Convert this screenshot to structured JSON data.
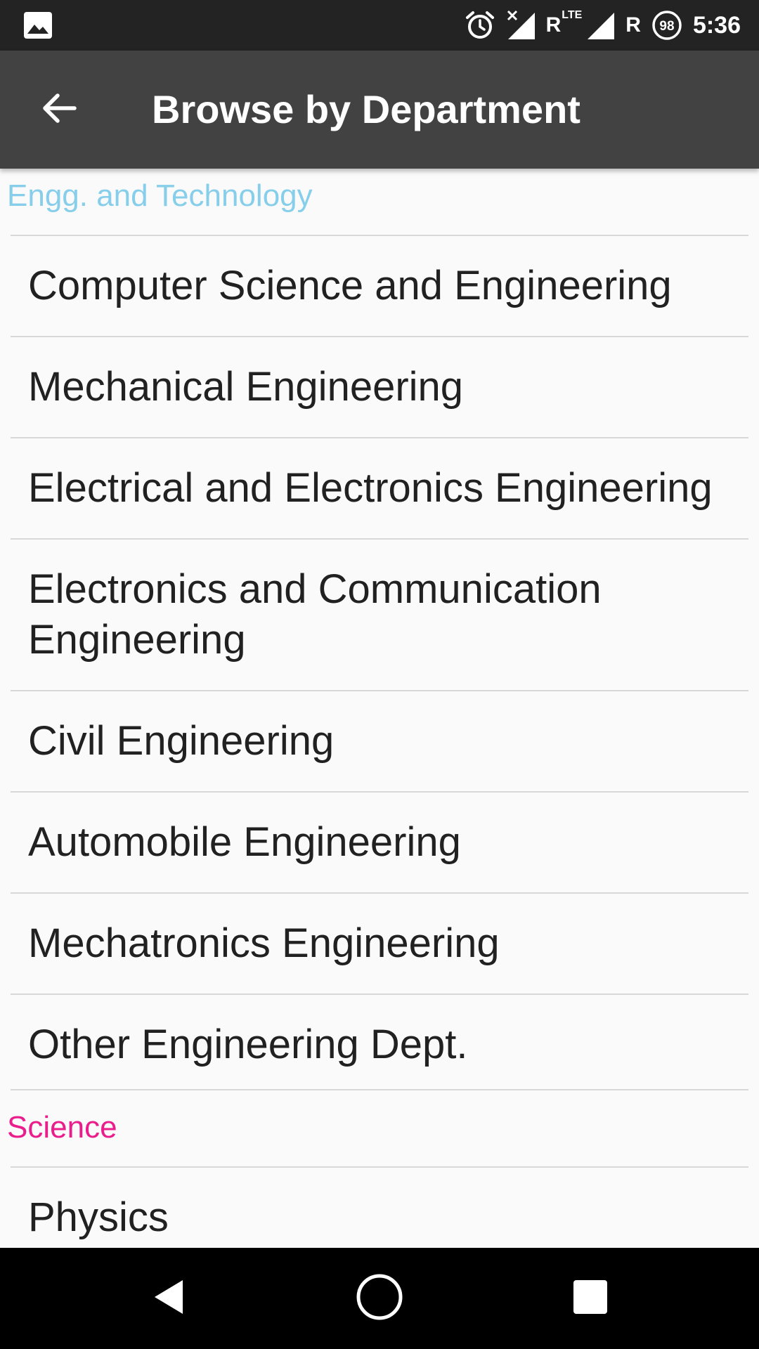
{
  "status_bar": {
    "time": "5:36",
    "battery_level": "98",
    "roaming_label_1": "R",
    "network_type": "LTE",
    "roaming_label_2": "R",
    "icons": [
      "image-icon",
      "alarm-icon",
      "signal-no-service-icon",
      "signal-lte-icon",
      "battery-saver-icon"
    ]
  },
  "app_bar": {
    "title": "Browse by Department",
    "back_icon": "arrow-back-icon",
    "background": "#424242"
  },
  "sections": [
    {
      "header": "Engg. and Technology",
      "header_color": "#87ceeb",
      "items": [
        "Computer Science and Engineering",
        "Mechanical Engineering",
        "Electrical and Electronics Engineering",
        "Electronics and Communication Engineering",
        "Civil Engineering",
        "Automobile Engineering",
        "Mechatronics Engineering",
        "Other Engineering Dept."
      ]
    },
    {
      "header": "Science",
      "header_color": "#e91e8c",
      "items": [
        "Physics"
      ]
    }
  ],
  "nav_bar": {
    "icons": [
      "nav-back-icon",
      "nav-home-icon",
      "nav-recents-icon"
    ]
  }
}
